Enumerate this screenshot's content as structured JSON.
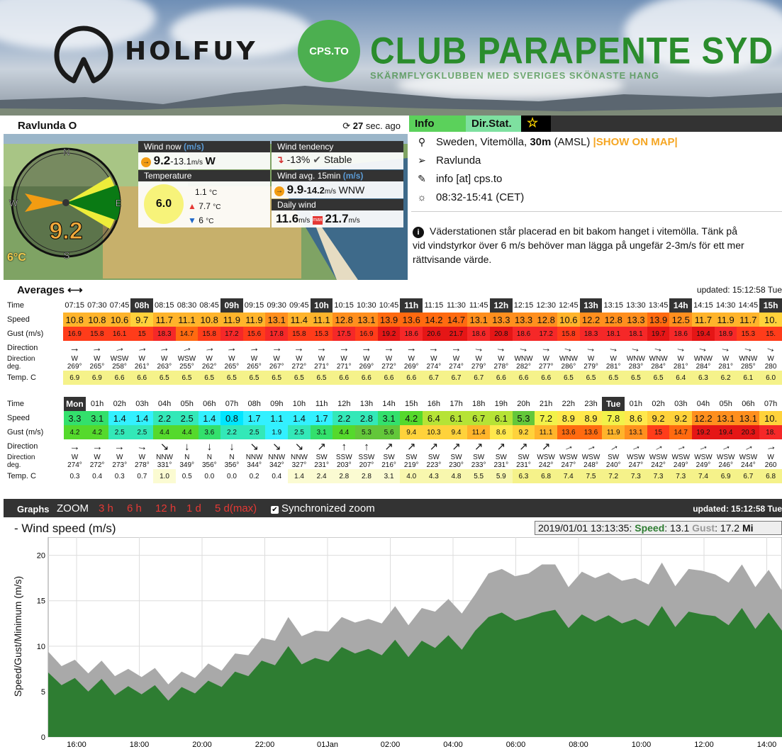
{
  "header": {
    "brand": "HOLFUY",
    "club_badge": "CPS.TO",
    "club_name": "CLUB PARAPENTE SYD",
    "club_tagline": "SKÄRMFLYGKLUBBEN MED SVERIGES SKÖNASTE HANG"
  },
  "station": {
    "name": "Ravlunda O",
    "updated_ago_num": "27",
    "updated_ago_text": "sec. ago",
    "compass": {
      "n": "N",
      "e": "E",
      "s": "S",
      "w": "W",
      "speed": "9.2",
      "temp": "6°C"
    },
    "wind_now": {
      "label": "Wind now",
      "unit_label": "(m/s)",
      "icon": "→",
      "speed": "9.2",
      "gust": "-13.1",
      "unit": "m/s",
      "dir": "W"
    },
    "tendency": {
      "label": "Wind tendency",
      "value": "-13%",
      "state": "Stable"
    },
    "temperature": {
      "label": "Temperature",
      "current": "6.0",
      "avg": "1.1",
      "max": "7.7",
      "min": "6",
      "unit": "°C"
    },
    "avg15": {
      "label": "Wind avg. 15min",
      "unit_label": "(m/s)",
      "speed": "9.9",
      "gust": "-14.2",
      "unit": "m/s",
      "dir": "WNW"
    },
    "daily": {
      "label": "Daily wind",
      "avg": "11.6",
      "max": "21.7",
      "unit": "m/s",
      "max_badge": "max"
    }
  },
  "info": {
    "tabs": {
      "info": "Info",
      "dir_stat": "Dir.Stat.",
      "fav": "☆"
    },
    "location": "Sweden, Vitemölla,",
    "altitude": "30m",
    "altitude_ref": "(AMSL)",
    "show_map": "|SHOW ON MAP|",
    "place": "Ravlunda",
    "contact": "info [at] cps.to",
    "daylight": "08:32-15:41 (CET)",
    "description_1": "Väderstationen står placerad en bit bakom hanget i vitemölla. Tänk på",
    "description_2": "vid vindstyrkor över 6 m/s behöver man lägga på ungefär 2-3m/s för ett mer",
    "description_3": "rättvisande värde."
  },
  "averages": {
    "title": "Averages",
    "updated": "updated: 15:12:58 Tue",
    "labels": {
      "time": "Time",
      "speed": "Speed",
      "gust": "Gust (m/s)",
      "direction": "Direction",
      "direction_deg_1": "Direction",
      "direction_deg_2": "deg.",
      "temp": "Temp. C"
    },
    "table1": [
      {
        "t": "07:15",
        "s": "10.8",
        "g": "16.9",
        "a": "→",
        "d": "W",
        "dg": "269°",
        "tc": "6.9",
        "r": 0
      },
      {
        "t": "07:30",
        "s": "10.8",
        "g": "15.8",
        "a": "→",
        "d": "W",
        "dg": "265°",
        "tc": "6.9",
        "r": -5
      },
      {
        "t": "07:45",
        "s": "10.6",
        "g": "16.1",
        "a": "→",
        "d": "WSW",
        "dg": "258°",
        "tc": "6.6",
        "r": -12
      },
      {
        "t": "08h",
        "s": "9.7",
        "g": "15",
        "a": "→",
        "d": "W",
        "dg": "261°",
        "tc": "6.6",
        "r": -9,
        "hr": true
      },
      {
        "t": "08:15",
        "s": "11.7",
        "g": "18.3",
        "a": "→",
        "d": "W",
        "dg": "263°",
        "tc": "6.5",
        "r": -7
      },
      {
        "t": "08:30",
        "s": "11.1",
        "g": "14.7",
        "a": "→",
        "d": "WSW",
        "dg": "255°",
        "tc": "6.5",
        "r": -15
      },
      {
        "t": "08:45",
        "s": "10.8",
        "g": "15.8",
        "a": "→",
        "d": "W",
        "dg": "262°",
        "tc": "6.5",
        "r": -8
      },
      {
        "t": "09h",
        "s": "11.9",
        "g": "17.2",
        "a": "→",
        "d": "W",
        "dg": "265°",
        "tc": "6.5",
        "r": -5,
        "hr": true
      },
      {
        "t": "09:15",
        "s": "11.9",
        "g": "15.6",
        "a": "→",
        "d": "W",
        "dg": "265°",
        "tc": "6.5",
        "r": -5
      },
      {
        "t": "09:30",
        "s": "13.1",
        "g": "17.8",
        "a": "→",
        "d": "W",
        "dg": "267°",
        "tc": "6.5",
        "r": -3
      },
      {
        "t": "09:45",
        "s": "11.4",
        "g": "15.8",
        "a": "→",
        "d": "W",
        "dg": "272°",
        "tc": "6.5",
        "r": 2
      },
      {
        "t": "10h",
        "s": "11.1",
        "g": "15.3",
        "a": "→",
        "d": "W",
        "dg": "271°",
        "tc": "6.5",
        "r": 1,
        "hr": true
      },
      {
        "t": "10:15",
        "s": "12.8",
        "g": "17.5",
        "a": "→",
        "d": "W",
        "dg": "271°",
        "tc": "6.6",
        "r": 1
      },
      {
        "t": "10:30",
        "s": "13.1",
        "g": "16.9",
        "a": "→",
        "d": "W",
        "dg": "269°",
        "tc": "6.6",
        "r": 0
      },
      {
        "t": "10:45",
        "s": "13.9",
        "g": "19.2",
        "a": "→",
        "d": "W",
        "dg": "272°",
        "tc": "6.6",
        "r": 2
      },
      {
        "t": "11h",
        "s": "13.6",
        "g": "18.6",
        "a": "→",
        "d": "W",
        "dg": "269°",
        "tc": "6.6",
        "r": 0,
        "hr": true
      },
      {
        "t": "11:15",
        "s": "14.2",
        "g": "20.6",
        "a": "→",
        "d": "W",
        "dg": "274°",
        "tc": "6.7",
        "r": 4
      },
      {
        "t": "11:30",
        "s": "14.7",
        "g": "21.7",
        "a": "→",
        "d": "W",
        "dg": "274°",
        "tc": "6.7",
        "r": 4
      },
      {
        "t": "11:45",
        "s": "13.1",
        "g": "18.6",
        "a": "→",
        "d": "W",
        "dg": "279°",
        "tc": "6.7",
        "r": 9
      },
      {
        "t": "12h",
        "s": "13.3",
        "g": "20.8",
        "a": "→",
        "d": "W",
        "dg": "278°",
        "tc": "6.6",
        "r": 8,
        "hr": true
      },
      {
        "t": "12:15",
        "s": "13.3",
        "g": "18.6",
        "a": "→",
        "d": "WNW",
        "dg": "282°",
        "tc": "6.6",
        "r": 12
      },
      {
        "t": "12:30",
        "s": "12.8",
        "g": "17.2",
        "a": "→",
        "d": "W",
        "dg": "277°",
        "tc": "6.6",
        "r": 7
      },
      {
        "t": "12:45",
        "s": "10.6",
        "g": "15.8",
        "a": "→",
        "d": "WNW",
        "dg": "286°",
        "tc": "6.5",
        "r": 16
      },
      {
        "t": "13h",
        "s": "12.2",
        "g": "18.3",
        "a": "→",
        "d": "W",
        "dg": "279°",
        "tc": "6.5",
        "r": 9,
        "hr": true
      },
      {
        "t": "13:15",
        "s": "12.8",
        "g": "18.1",
        "a": "→",
        "d": "W",
        "dg": "281°",
        "tc": "6.5",
        "r": 11
      },
      {
        "t": "13:30",
        "s": "13.3",
        "g": "18.1",
        "a": "→",
        "d": "WNW",
        "dg": "283°",
        "tc": "6.5",
        "r": 13
      },
      {
        "t": "13:45",
        "s": "13.9",
        "g": "19.7",
        "a": "→",
        "d": "WNW",
        "dg": "284°",
        "tc": "6.5",
        "r": 14
      },
      {
        "t": "14h",
        "s": "12.5",
        "g": "18.6",
        "a": "→",
        "d": "W",
        "dg": "281°",
        "tc": "6.4",
        "r": 11,
        "hr": true
      },
      {
        "t": "14:15",
        "s": "11.7",
        "g": "19.4",
        "a": "→",
        "d": "WNW",
        "dg": "284°",
        "tc": "6.3",
        "r": 14
      },
      {
        "t": "14:30",
        "s": "11.9",
        "g": "18.9",
        "a": "→",
        "d": "W",
        "dg": "281°",
        "tc": "6.2",
        "r": 11
      },
      {
        "t": "14:45",
        "s": "11.7",
        "g": "15.3",
        "a": "→",
        "d": "WNW",
        "dg": "285°",
        "tc": "6.1",
        "r": 15
      },
      {
        "t": "15h",
        "s": "10.",
        "g": "15.",
        "a": "→",
        "d": "W",
        "dg": "280",
        "tc": "6.0",
        "r": 20,
        "hr": true
      }
    ],
    "table2": [
      {
        "t": "Mon",
        "s": "3.3",
        "g": "4.2",
        "a": "→",
        "d": "W",
        "dg": "274°",
        "tc": "0.3",
        "r": 4,
        "hr": true
      },
      {
        "t": "01h",
        "s": "3.1",
        "g": "4.2",
        "a": "→",
        "d": "W",
        "dg": "272°",
        "tc": "0.4",
        "r": 2
      },
      {
        "t": "02h",
        "s": "1.4",
        "g": "2.5",
        "a": "→",
        "d": "W",
        "dg": "273°",
        "tc": "0.3",
        "r": 3
      },
      {
        "t": "03h",
        "s": "1.4",
        "g": "2.5",
        "a": "→",
        "d": "W",
        "dg": "278°",
        "tc": "0.7",
        "r": 8
      },
      {
        "t": "04h",
        "s": "2.2",
        "g": "4.4",
        "a": "↘",
        "d": "NNW",
        "dg": "331°",
        "tc": "1.0",
        "r": 0
      },
      {
        "t": "05h",
        "s": "2.5",
        "g": "4.4",
        "a": "↓",
        "d": "N",
        "dg": "349°",
        "tc": "0.5",
        "r": 0
      },
      {
        "t": "06h",
        "s": "1.4",
        "g": "3.6",
        "a": "↓",
        "d": "N",
        "dg": "356°",
        "tc": "0.0",
        "r": 0
      },
      {
        "t": "07h",
        "s": "0.8",
        "g": "2.2",
        "a": "↓",
        "d": "N",
        "dg": "356°",
        "tc": "0.0",
        "r": 0
      },
      {
        "t": "08h",
        "s": "1.7",
        "g": "2.5",
        "a": "↘",
        "d": "NNW",
        "dg": "344°",
        "tc": "0.2",
        "r": 0
      },
      {
        "t": "09h",
        "s": "1.1",
        "g": "1.9",
        "a": "↘",
        "d": "NNW",
        "dg": "342°",
        "tc": "0.4",
        "r": 0
      },
      {
        "t": "10h",
        "s": "1.4",
        "g": "2.5",
        "a": "↘",
        "d": "NNW",
        "dg": "327°",
        "tc": "1.4",
        "r": 0
      },
      {
        "t": "11h",
        "s": "1.7",
        "g": "3.1",
        "a": "↗",
        "d": "SW",
        "dg": "231°",
        "tc": "2.4",
        "r": 0
      },
      {
        "t": "12h",
        "s": "2.2",
        "g": "4.4",
        "a": "↑",
        "d": "SSW",
        "dg": "203°",
        "tc": "2.8",
        "r": 0
      },
      {
        "t": "13h",
        "s": "2.8",
        "g": "5.3",
        "a": "↑",
        "d": "SSW",
        "dg": "207°",
        "tc": "2.8",
        "r": 0
      },
      {
        "t": "14h",
        "s": "3.1",
        "g": "5.6",
        "a": "↗",
        "d": "SW",
        "dg": "216°",
        "tc": "3.1",
        "r": 0
      },
      {
        "t": "15h",
        "s": "4.2",
        "g": "9.4",
        "a": "↗",
        "d": "SW",
        "dg": "219°",
        "tc": "4.0",
        "r": 0
      },
      {
        "t": "16h",
        "s": "6.4",
        "g": "10.3",
        "a": "↗",
        "d": "SW",
        "dg": "223°",
        "tc": "4.3",
        "r": 0
      },
      {
        "t": "17h",
        "s": "6.1",
        "g": "9.4",
        "a": "↗",
        "d": "SW",
        "dg": "230°",
        "tc": "4.8",
        "r": 0
      },
      {
        "t": "18h",
        "s": "6.7",
        "g": "11.4",
        "a": "↗",
        "d": "SW",
        "dg": "233°",
        "tc": "5.5",
        "r": 0
      },
      {
        "t": "19h",
        "s": "6.1",
        "g": "8.6",
        "a": "↗",
        "d": "SW",
        "dg": "231°",
        "tc": "5.9",
        "r": 0
      },
      {
        "t": "20h",
        "s": "5.3",
        "g": "9.2",
        "a": "↗",
        "d": "SW",
        "dg": "231°",
        "tc": "6.3",
        "r": 0
      },
      {
        "t": "21h",
        "s": "7.2",
        "g": "11.1",
        "a": "↗",
        "d": "WSW",
        "dg": "242°",
        "tc": "6.8",
        "r": 0
      },
      {
        "t": "22h",
        "s": "8.9",
        "g": "13.6",
        "a": "→",
        "d": "WSW",
        "dg": "247°",
        "tc": "7.4",
        "r": -23
      },
      {
        "t": "23h",
        "s": "8.9",
        "g": "13.6",
        "a": "→",
        "d": "WSW",
        "dg": "248°",
        "tc": "7.5",
        "r": -22
      },
      {
        "t": "Tue",
        "s": "7.8",
        "g": "11.9",
        "a": "→",
        "d": "SW",
        "dg": "240°",
        "tc": "7.2",
        "r": -30,
        "hr": true
      },
      {
        "t": "01h",
        "s": "8.6",
        "g": "13.1",
        "a": "→",
        "d": "WSW",
        "dg": "247°",
        "tc": "7.3",
        "r": -23
      },
      {
        "t": "02h",
        "s": "9.2",
        "g": "15",
        "a": "→",
        "d": "WSW",
        "dg": "242°",
        "tc": "7.3",
        "r": -28
      },
      {
        "t": "03h",
        "s": "9.2",
        "g": "14.7",
        "a": "→",
        "d": "WSW",
        "dg": "249°",
        "tc": "7.3",
        "r": -21
      },
      {
        "t": "04h",
        "s": "12.2",
        "g": "19.2",
        "a": "→",
        "d": "WSW",
        "dg": "249°",
        "tc": "7.4",
        "r": -21
      },
      {
        "t": "05h",
        "s": "13.1",
        "g": "19.4",
        "a": "→",
        "d": "WSW",
        "dg": "246°",
        "tc": "6.9",
        "r": -24
      },
      {
        "t": "06h",
        "s": "13.1",
        "g": "20.3",
        "a": "→",
        "d": "WSW",
        "dg": "244°",
        "tc": "6.7",
        "r": -26
      },
      {
        "t": "07h",
        "s": "10.",
        "g": "18.",
        "a": "→",
        "d": "W",
        "dg": "260",
        "tc": "6.8",
        "r": -10
      }
    ]
  },
  "graphs": {
    "title": "Graphs",
    "zoom_label": "ZOOM",
    "zoom_options": [
      "3 h",
      "6 h",
      "12 h",
      "1 d",
      "5 d(max)"
    ],
    "sync_label": "Synchronized zoom",
    "updated": "updated: 15:12:58 Tue"
  },
  "chart_data": {
    "type": "area",
    "title": "- Wind speed (m/s)",
    "ylabel": "Speed/Gust/Minimum (m/s)",
    "ylim": [
      0,
      22
    ],
    "yticks": [
      0,
      5,
      10,
      15,
      20
    ],
    "xticks": [
      "16:00",
      "18:00",
      "20:00",
      "22:00",
      "01Jan",
      "02:00",
      "04:00",
      "06:00",
      "08:00",
      "10:00",
      "12:00",
      "14:00"
    ],
    "readout": {
      "time": "2019/01/01 13:13:35:",
      "speed_label": "Speed",
      "speed": "13.1",
      "gust_label": "Gust",
      "gust": "17.2",
      "min_label": "Mi"
    },
    "series": [
      {
        "name": "Gust",
        "color": "#a9a9a9",
        "values": [
          8.8,
          8.4,
          7.9,
          7.6,
          7.8,
          7.3,
          6.9,
          7.2,
          7.0,
          6.4,
          6.6,
          7.1,
          7.5,
          7.9,
          8.6,
          9.6,
          10.3,
          11.2,
          12.6,
          11.7,
          11.1,
          12.2,
          12.6,
          13.2,
          12.4,
          13.1,
          13.8,
          12.9,
          13.6,
          14.4,
          14.6,
          14.2,
          15.1,
          18.6,
          17.9,
          18.3,
          17.4,
          19.6,
          18.4,
          17.1,
          17.6,
          18.1,
          17.5,
          17.8,
          16.9,
          17.4,
          18.6,
          17.2,
          17.9,
          18.9,
          17.3,
          17.6,
          18.4,
          17.1,
          17.8,
          16.7
        ]
      },
      {
        "name": "Speed",
        "color": "#2e7d32",
        "values": [
          6.5,
          6.3,
          5.9,
          5.6,
          5.8,
          5.2,
          5.0,
          5.3,
          5.1,
          4.6,
          4.9,
          5.4,
          5.6,
          6.1,
          6.6,
          7.3,
          7.8,
          8.5,
          9.4,
          8.6,
          8.1,
          8.9,
          9.3,
          9.8,
          9.1,
          9.6,
          10.1,
          9.4,
          10.0,
          10.4,
          10.6,
          10.2,
          11.1,
          13.8,
          13.1,
          13.4,
          12.6,
          14.3,
          13.4,
          12.6,
          12.9,
          13.3,
          12.8,
          13.1,
          12.4,
          12.8,
          13.8,
          12.7,
          13.2,
          14.1,
          12.7,
          12.9,
          13.6,
          12.5,
          13.1,
          12.3
        ]
      }
    ]
  }
}
